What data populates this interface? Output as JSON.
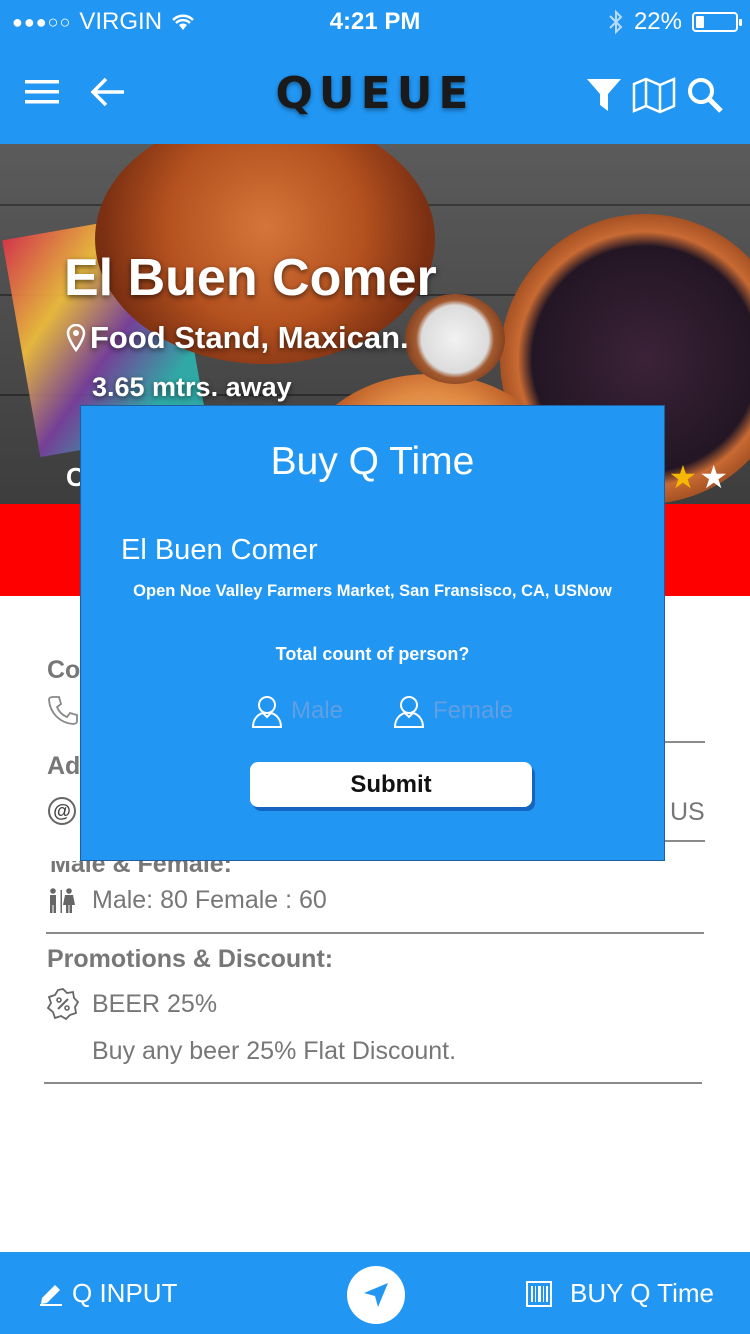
{
  "status": {
    "carrier": "VIRGIN",
    "time": "4:21 PM",
    "battery": "22%",
    "battery_level": 0.22
  },
  "nav": {
    "brand": "QUEUE"
  },
  "hero": {
    "title": "El Buen Comer",
    "subtitle": "Food Stand, Maxican.",
    "distance": "3.65 mtrs. away",
    "partial_text": "C",
    "rating_shown": "2 stars visible"
  },
  "details": {
    "contact_label_partial": "Co",
    "address_label_partial": "Ad",
    "address_value_partial": "US",
    "gender_label": "Male & Female:",
    "gender_value": "Male: 80 Female : 60",
    "promotions_label": "Promotions & Discount:",
    "promo_title": "BEER 25%",
    "promo_desc": "Buy any beer 25% Flat Discount."
  },
  "modal": {
    "title": "Buy Q Time",
    "name": "El Buen Comer",
    "address": "Open Noe Valley Farmers Market, San Fransisco, CA, USNow",
    "question": "Total count of person?",
    "male_placeholder": "Male",
    "female_placeholder": "Female",
    "submit_label": "Submit"
  },
  "bottom": {
    "left_label": "Q INPUT",
    "right_label": "BUY Q Time"
  },
  "colors": {
    "primary": "#2196f3",
    "accent_red": "#ff0000",
    "star": "#f5b800"
  }
}
